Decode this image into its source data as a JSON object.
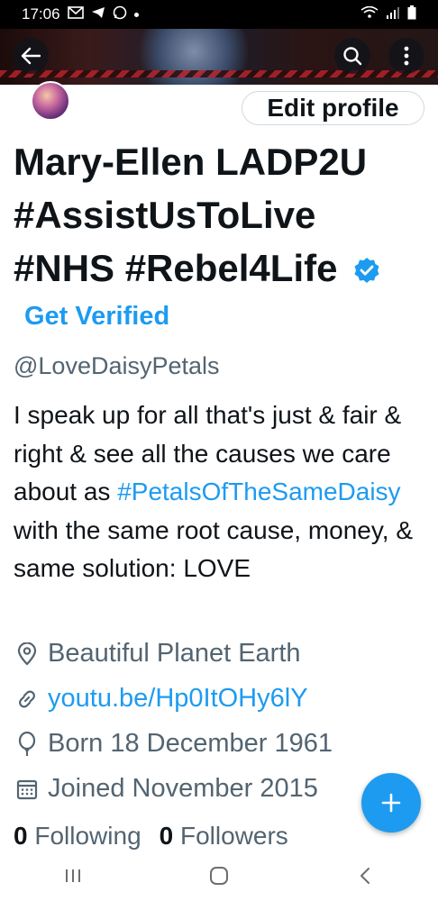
{
  "status_bar": {
    "time": "17:06"
  },
  "profile": {
    "edit_profile_label": "Edit profile",
    "display_name_line1": "Mary-Ellen LADP2U",
    "display_name_line2": "#AssistUsToLive",
    "display_name_line3": "#NHS #Rebel4Life",
    "get_verified_label": "Get Verified",
    "handle": "@LoveDaisyPetals",
    "bio_part1": "I speak up for all that's just & fair & right & see all the causes we care about as ",
    "bio_hashtag": "#PetalsOfTheSameDaisy",
    "bio_part2": " with the same root cause, money, & same solution: LOVE",
    "location": "Beautiful Planet Earth",
    "website": "youtu.be/Hp0ItOHy6lY",
    "birthday": "Born 18 December 1961",
    "joined": "Joined November 2015",
    "following_count": "0",
    "following_label": "Following",
    "followers_count": "0",
    "followers_label": "Followers"
  },
  "colors": {
    "accent": "#1d9bf0",
    "text": "#0f1419",
    "muted": "#536471"
  }
}
